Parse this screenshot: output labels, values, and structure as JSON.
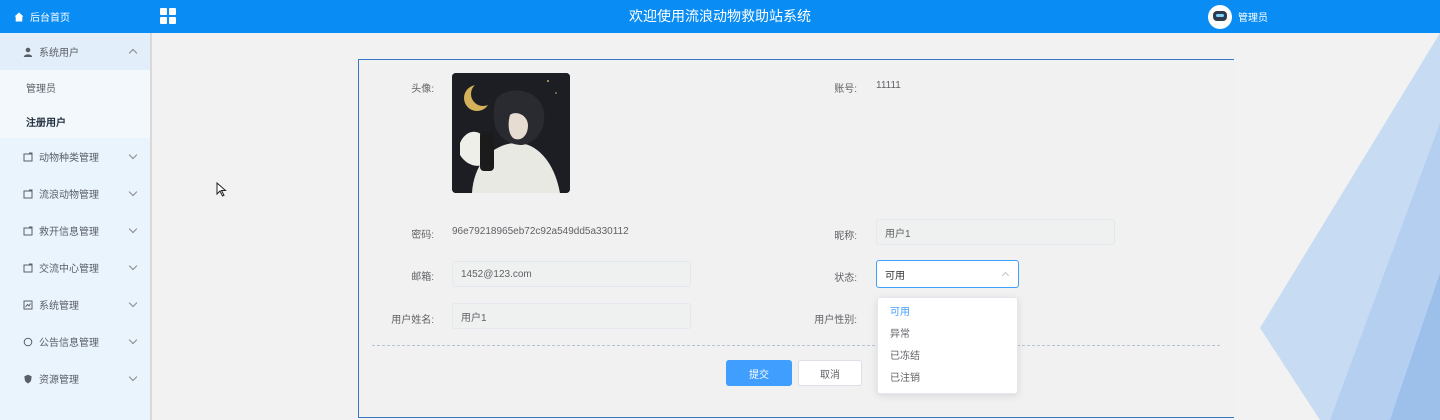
{
  "topbar": {
    "brand": "后台首页",
    "title": "欢迎使用流浪动物救助站系统",
    "user_name": "管理员"
  },
  "sidebar": {
    "items": [
      {
        "label": "系统用户",
        "icon": "user-icon",
        "open": true,
        "children": [
          {
            "label": "管理员"
          },
          {
            "label": "注册用户",
            "active": true
          }
        ]
      },
      {
        "label": "动物种类管理",
        "icon": "folder-icon"
      },
      {
        "label": "流浪动物管理",
        "icon": "folder-icon"
      },
      {
        "label": "救开信息管理",
        "icon": "folder-icon"
      },
      {
        "label": "交流中心管理",
        "icon": "folder-icon"
      },
      {
        "label": "系统管理",
        "icon": "settings-box-icon"
      },
      {
        "label": "公告信息管理",
        "icon": "circle-icon"
      },
      {
        "label": "资源管理",
        "icon": "shield-icon"
      }
    ]
  },
  "form": {
    "avatar_label": "头像:",
    "account_label": "账号:",
    "account_value": "11111",
    "password_label": "密码:",
    "password_value": "96e79218965eb72c92a549dd5a330112",
    "nickname_label": "昵称:",
    "nickname_value": "用户1",
    "email_label": "邮箱:",
    "email_value": "1452@123.com",
    "status_label": "状态:",
    "status_value": "可用",
    "realname_label": "用户姓名:",
    "realname_value": "用户1",
    "gender_label": "用户性别:",
    "status_options": [
      "可用",
      "异常",
      "已冻结",
      "已注销"
    ],
    "submit_label": "提交",
    "cancel_label": "取消"
  },
  "colors": {
    "topbar": "#0a8cf5",
    "primary": "#409eff",
    "sidebar_bg": "#eaf4fd",
    "card_border": "#3a76c2"
  }
}
